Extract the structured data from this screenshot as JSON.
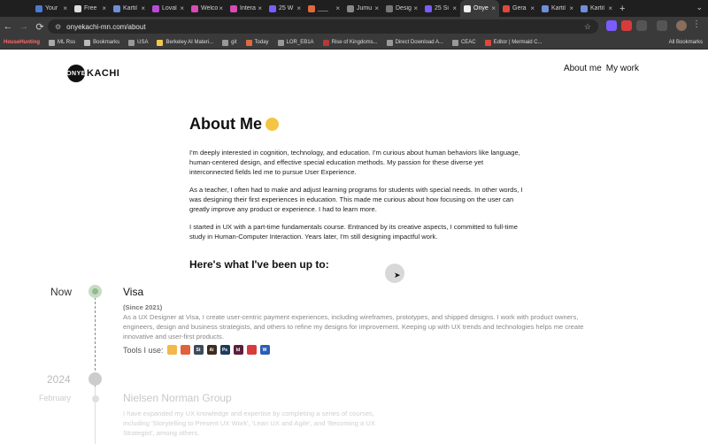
{
  "browser": {
    "tabs": [
      {
        "label": "Your",
        "color": "#4a7bd0"
      },
      {
        "label": "Free",
        "color": "#ddd"
      },
      {
        "label": "Kartil",
        "color": "#6f8fd8"
      },
      {
        "label": "Loval",
        "color": "#b94bd8"
      },
      {
        "label": "Welco",
        "color": "#d84bb5"
      },
      {
        "label": "Intera",
        "color": "#d84bb5"
      },
      {
        "label": "25 W",
        "color": "#7b5cff"
      },
      {
        "label": "___",
        "color": "#e0693b"
      },
      {
        "label": "Jumu",
        "color": "#888"
      },
      {
        "label": "Desig",
        "color": "#777"
      },
      {
        "label": "25 Si",
        "color": "#7b5cff"
      },
      {
        "label": "Onye",
        "color": "#eee",
        "active": true
      },
      {
        "label": "Gera",
        "color": "#e0473b"
      },
      {
        "label": "Kartil",
        "color": "#6f8fd8"
      },
      {
        "label": "Kartil",
        "color": "#6f8fd8"
      }
    ],
    "url": "onyekachi-mn.com/about",
    "bookmarks": [
      {
        "label": "HouseHunting",
        "color": "#e03b3b"
      },
      {
        "label": "ML Rss",
        "color": "#aaa"
      },
      {
        "label": "Bookmarks",
        "color": "#bbb"
      },
      {
        "label": "USA",
        "color": "#999"
      },
      {
        "label": "Berkeley AI Materi...",
        "color": "#f2c94c"
      },
      {
        "label": "git",
        "color": "#999"
      },
      {
        "label": "Today",
        "color": "#e0693b"
      },
      {
        "label": "LOR_EB1A",
        "color": "#999"
      },
      {
        "label": "Rise of Kingdoms...",
        "color": "#b03b3b"
      },
      {
        "label": "Direct Download A...",
        "color": "#999"
      },
      {
        "label": "CEAC",
        "color": "#999"
      },
      {
        "label": "Editor | Mermaid C...",
        "color": "#e0473b"
      }
    ],
    "all_bookmarks": "All Bookmarks"
  },
  "site": {
    "logo_badge": "ONYE",
    "logo_rest": "KACHI",
    "nav": {
      "about": "About me",
      "work": "My work"
    }
  },
  "about": {
    "title": "About Me",
    "paragraphs": [
      "I'm deeply interested in cognition, technology, and education. I'm curious about human behaviors like language, human-centered design, and effective special education methods. My passion for these diverse yet interconnected fields led me to pursue User Experience.",
      "As a teacher, I often had to make and adjust learning programs for students with special needs. In other words, I was designing their first experiences in education. This made me curious about how focusing on the user can greatly improve any product or experience. I had to learn more.",
      "I started in UX with a part-time fundamentals course. Entranced by its creative aspects, I committed to full-time study in Human-Computer Interaction. Years later, I'm still designing impactful work."
    ],
    "subtitle": "Here's what I've been up to:"
  },
  "timeline": {
    "now_label": "Now",
    "year_label": "2024",
    "month_label": "February",
    "job1": {
      "title": "Visa",
      "since": "(Since 2021)",
      "desc": "As a UX Designer at Visa, I create user-centric payment experiences, including wireframes, prototypes, and shipped designs. I work with product owners, engineers, design and business strategists, and others to refine my designs for improvement. Keeping up with UX trends and technologies helps me create innovative and user-first products.",
      "tools_label": "Tools I use:",
      "tools": [
        {
          "name": "sketch",
          "abbr": "",
          "color": "#f2b84b"
        },
        {
          "name": "figma",
          "abbr": "",
          "color": "#e0613b"
        },
        {
          "name": "storybook",
          "abbr": "St",
          "color": "#3d4b5c"
        },
        {
          "name": "illustrator",
          "abbr": "Ai",
          "color": "#3d2b1f"
        },
        {
          "name": "photoshop",
          "abbr": "Ps",
          "color": "#1f3b5c"
        },
        {
          "name": "indesign",
          "abbr": "Id",
          "color": "#5c1f3b"
        },
        {
          "name": "acrobat",
          "abbr": "",
          "color": "#d83b3b"
        },
        {
          "name": "word",
          "abbr": "W",
          "color": "#2b5cb8"
        }
      ]
    },
    "job2": {
      "title": "Nielsen Norman Group",
      "desc": "I have expanded my UX knowledge and expertise by completing a series of courses, including 'Storytelling to Present UX Work', 'Lean UX and Agile', and 'Becoming a UX Strategist', among others."
    }
  }
}
